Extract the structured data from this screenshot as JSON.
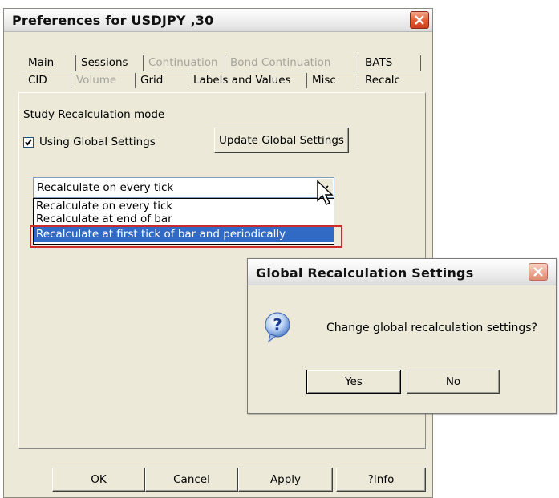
{
  "prefs_dialog": {
    "title": "Preferences for USDJPY ,30",
    "tabs_row1": [
      {
        "label": "Main",
        "enabled": true
      },
      {
        "label": "Sessions",
        "enabled": true
      },
      {
        "label": "Continuation",
        "enabled": false
      },
      {
        "label": "Bond Continuation",
        "enabled": false
      },
      {
        "label": "BATS",
        "enabled": true
      }
    ],
    "tabs_row2": [
      {
        "label": "CID",
        "enabled": true
      },
      {
        "label": "Volume",
        "enabled": false
      },
      {
        "label": "Grid",
        "enabled": true
      },
      {
        "label": "Labels and Values",
        "enabled": true
      },
      {
        "label": "Misc",
        "enabled": true
      },
      {
        "label": "Recalc",
        "enabled": true,
        "active": true
      }
    ],
    "section_label": "Study Recalculation mode",
    "use_global_checkbox": {
      "label": "Using Global Settings",
      "checked": true
    },
    "update_global_button": "Update Global Settings",
    "mode_select": {
      "value": "Recalculate on every tick",
      "options": [
        "Recalculate on every tick",
        "Recalculate at end of bar",
        "Recalculate at first tick of bar and periodically"
      ],
      "highlighted_option_index": 2
    },
    "buttons": {
      "ok": "OK",
      "cancel": "Cancel",
      "apply": "Apply",
      "info": "?Info"
    }
  },
  "global_dialog": {
    "title": "Global Recalculation Settings",
    "message": "Change global recalculation settings?",
    "icon": "question-icon",
    "yes_label": "Yes",
    "no_label": "No"
  },
  "colors": {
    "highlight_box": "#cc2b2b",
    "selected_option_bg": "#316ac5",
    "dialog_bg": "#ece9d8"
  }
}
